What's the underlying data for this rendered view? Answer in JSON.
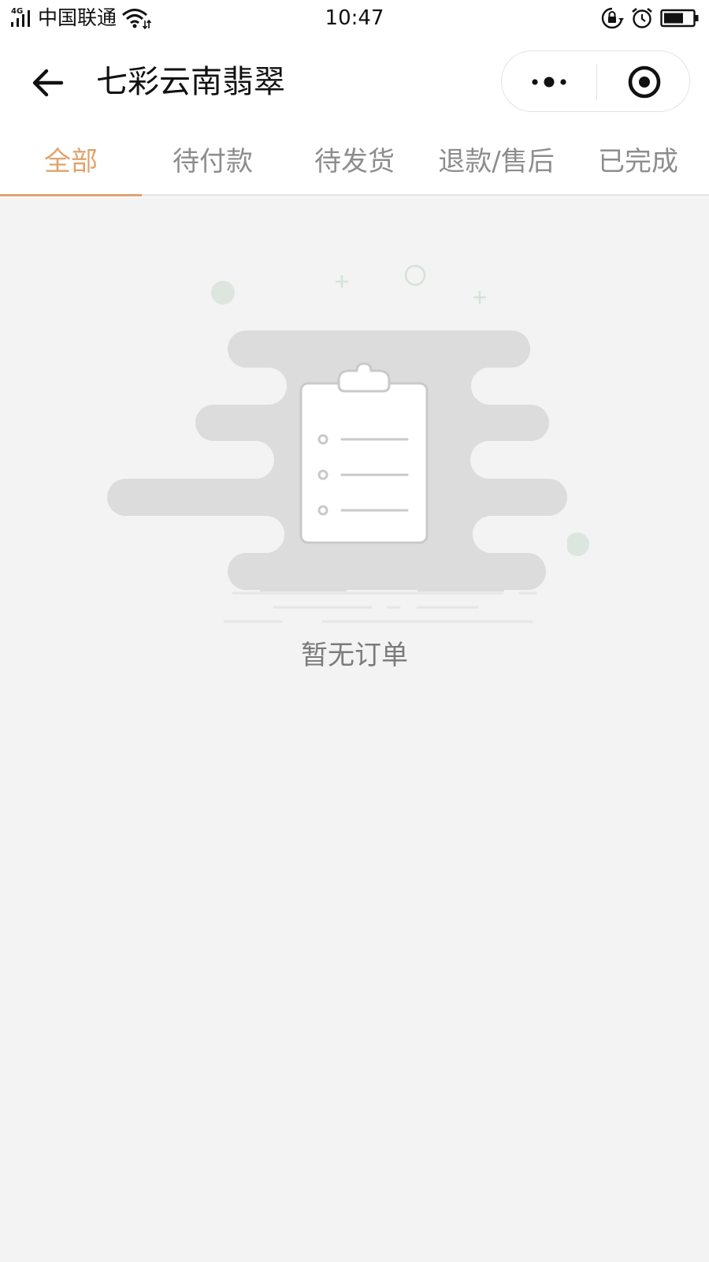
{
  "status_bar": {
    "network": "4G",
    "carrier": "中国联通",
    "time": "10:47"
  },
  "nav": {
    "title": "七彩云南翡翠"
  },
  "tabs": [
    {
      "label": "全部",
      "active": true
    },
    {
      "label": "待付款",
      "active": false
    },
    {
      "label": "待发货",
      "active": false
    },
    {
      "label": "退款/售后",
      "active": false
    },
    {
      "label": "已完成",
      "active": false
    }
  ],
  "empty_state": {
    "message": "暂无订单",
    "icon": "clipboard-icon"
  },
  "colors": {
    "accent": "#e0a36d",
    "background": "#f3f3f3",
    "inactive_tab": "#8d8d8d"
  }
}
